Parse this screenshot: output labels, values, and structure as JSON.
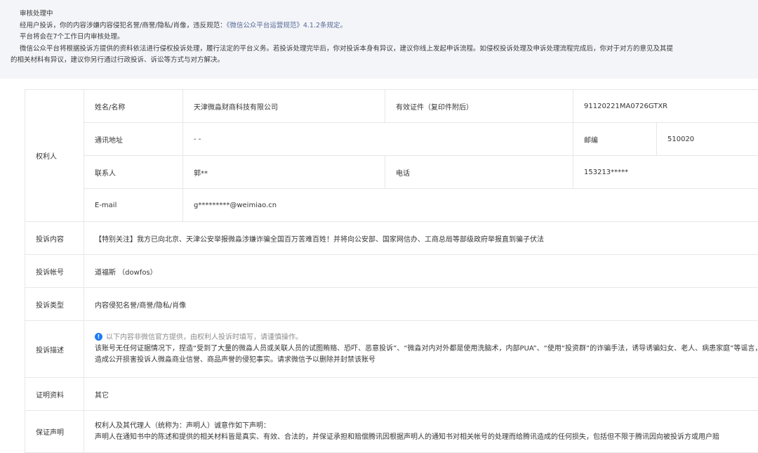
{
  "notice": {
    "status": "审核处理中",
    "line1_prefix": "经用户投诉，你的内容涉嫌内容侵犯名誉/商誉/隐私/肖像，违反规范：",
    "line1_link": "《微信公众平台运营规范》4.1.2条规定。",
    "line2": "平台将会在7个工作日内审核处理。",
    "line3": "微信公众平台将根据投诉方提供的资料依法进行侵权投诉处理，履行法定的平台义务。若投诉处理完毕后，你对投诉本身有异议，建议你线上发起申诉流程。如侵权投诉处理及申诉处理流程完成后，你对于对方的意见及其提",
    "line4": "的相关材料有异议，建议你另行通过行政投诉、诉讼等方式与对方解决。"
  },
  "table": {
    "rights_holder_label": "权利人",
    "name_label": "姓名/名称",
    "name_value": "天津微淼财商科技有限公司",
    "id_label": "有效证件（复印件附后）",
    "id_value": "91120221MA0726GTXR",
    "address_label": "通讯地址",
    "address_value": "- -",
    "postcode_label": "邮编",
    "postcode_value": "510020",
    "contact_label": "联系人",
    "contact_value": "郭**",
    "phone_label": "电话",
    "phone_value": "153213*****",
    "email_label": "E-mail",
    "email_value": "g*********@weimiao.cn",
    "complaint_content_label": "投诉内容",
    "complaint_content_value": "【特别关注】我方已向北京、天津公安举报微淼涉嫌诈骗全国百万苦难百姓！并将向公安部、国家网信办、工商总局等部级政府举报直到骗子伏法",
    "account_label": "投诉帐号",
    "account_value": "道福斯 （dowfos）",
    "type_label": "投诉类型",
    "type_value": "内容侵犯名誉/商誉/隐私/肖像",
    "desc_label": "投诉描述",
    "desc_tip": "以下内容非微信官方提供，由权利人投诉时填写，请谨慎操作。",
    "desc_value": "该账号无任何证据情况下，捏造“受到了大量的微淼人员或关联人员的试图贿赂、恐吓、恶意投诉”、“微淼对内对外都是使用洗脑术，内部PUA”、“使用“投资群”的诈骗手法，诱导诱骗妇女、老人、病患家庭”等谣言，造成公开损害投诉人微淼商业信誉、商品声誉的侵犯事实。请求微信予以删除并封禁该账号",
    "proof_label": "证明资料",
    "proof_value": "其它",
    "statement_label": "保证声明",
    "statement_line1": "权利人及其代理人（统称为：声明人）诚意作如下声明：",
    "statement_line2": "声明人在通知书中的陈述和提供的相关材料皆是真实、有效、合法的，并保证承担和赔偿腾讯因根据声明人的通知书对相关帐号的处理而给腾讯造成的任何损失，包括但不限于腾讯因向被投诉方或用户赔"
  }
}
